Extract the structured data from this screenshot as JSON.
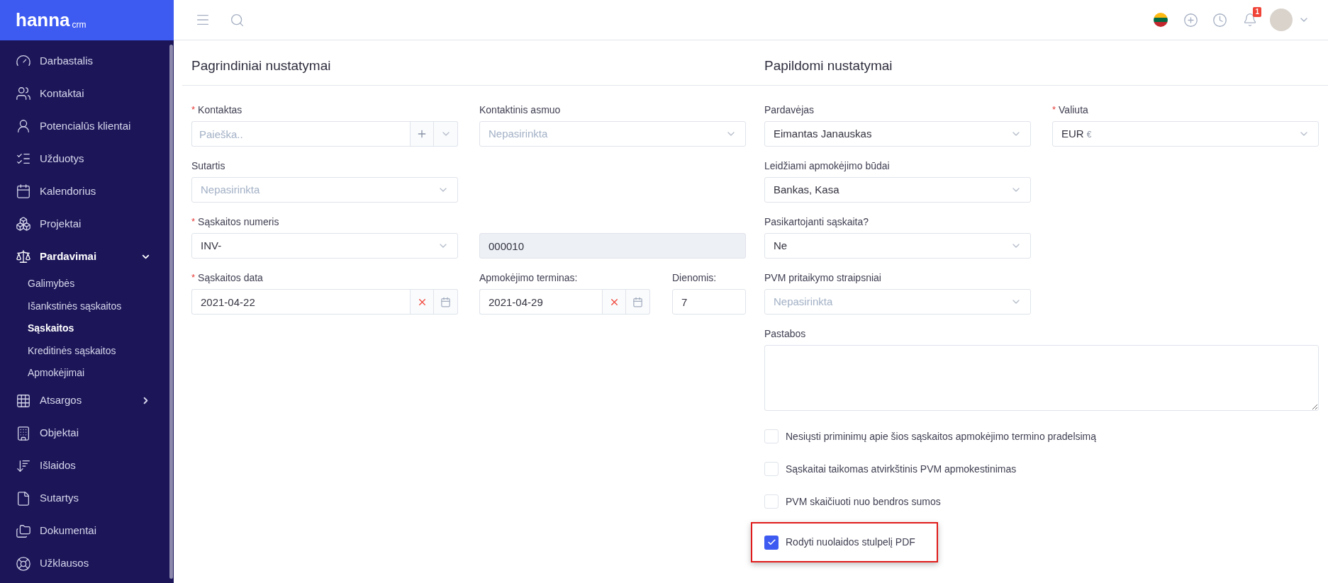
{
  "logo": {
    "name": "hanna",
    "suffix": "crm"
  },
  "sidebar": {
    "items": [
      {
        "label": "Darbastalis",
        "selected": false
      },
      {
        "label": "Kontaktai",
        "selected": false
      },
      {
        "label": "Potencialūs klientai",
        "selected": false
      },
      {
        "label": "Užduotys",
        "selected": false
      },
      {
        "label": "Kalendorius",
        "selected": false
      },
      {
        "label": "Projektai",
        "selected": false
      },
      {
        "label": "Pardavimai",
        "selected": true,
        "expanded": true,
        "children": [
          {
            "label": "Galimybės",
            "selected": false
          },
          {
            "label": "Išankstinės sąskaitos",
            "selected": false
          },
          {
            "label": "Sąskaitos",
            "selected": true
          },
          {
            "label": "Kreditinės sąskaitos",
            "selected": false
          },
          {
            "label": "Apmokėjimai",
            "selected": false
          }
        ]
      },
      {
        "label": "Atsargos",
        "selected": false,
        "expanded": false
      },
      {
        "label": "Objektai",
        "selected": false
      },
      {
        "label": "Išlaidos",
        "selected": false
      },
      {
        "label": "Sutartys",
        "selected": false
      },
      {
        "label": "Dokumentai",
        "selected": false
      },
      {
        "label": "Užklausos",
        "selected": false
      }
    ]
  },
  "topbar": {
    "notifications": "1"
  },
  "sections": [
    {
      "title": "Pagrindiniai nustatymai",
      "rows": [
        [
          [
            {
              "kind": "search",
              "label": "Kontaktas",
              "required_mark": "*",
              "placeholder": "Paieška.."
            }
          ],
          [
            {
              "kind": "select",
              "label": "Kontaktinis asmuo",
              "placeholder": "Nepasirinkta"
            }
          ]
        ],
        [
          [
            {
              "kind": "select",
              "label": "Sutartis",
              "placeholder": "Nepasirinkta"
            }
          ]
        ],
        [
          [
            {
              "kind": "select",
              "label": "Sąskaitos numeris",
              "required_mark": "*",
              "value": "INV-"
            }
          ],
          [
            {
              "kind": "readonly",
              "value": "000010"
            }
          ]
        ],
        [
          [
            {
              "kind": "date",
              "label": "Sąskaitos data",
              "required_mark": "*",
              "value": "2021-04-22"
            }
          ],
          [
            {
              "kind": "date",
              "label": "Apmokėjimo terminas:",
              "value": "2021-04-29"
            },
            {
              "kind": "text",
              "label": "Dienomis:",
              "value": "7"
            }
          ]
        ]
      ]
    },
    {
      "title": "Papildomi nustatymai",
      "rows": [
        [
          [
            {
              "kind": "select",
              "label": "Pardavėjas",
              "value": "Eimantas Janauskas"
            }
          ],
          [
            {
              "kind": "select",
              "label": "Valiuta",
              "required_mark": "*",
              "value": "EUR",
              "suffix": "€"
            }
          ]
        ],
        [
          [
            {
              "kind": "select",
              "label": "Leidžiami apmokėjimo būdai",
              "value": "Bankas, Kasa"
            }
          ]
        ],
        [
          [
            {
              "kind": "select",
              "label": "Pasikartojanti sąskaita?",
              "value": "Ne"
            }
          ]
        ],
        [
          [
            {
              "kind": "select",
              "label": "PVM pritaikymo straipsniai",
              "placeholder": "Nepasirinkta"
            }
          ]
        ],
        [
          [
            {
              "kind": "textarea",
              "label": "Pastabos"
            }
          ]
        ]
      ],
      "checkboxes": [
        {
          "label": "Nesiųsti priminimų apie šios sąskaitos apmokėjimo termino pradelsimą",
          "checked": false,
          "highlighted": false
        },
        {
          "label": "Sąskaitai taikomas atvirkštinis PVM apmokestinimas",
          "checked": false,
          "highlighted": false
        },
        {
          "label": "PVM skaičiuoti nuo bendros sumos",
          "checked": false,
          "highlighted": false
        },
        {
          "label": "Rodyti nuolaidos stulpelį PDF",
          "checked": true,
          "highlighted": true
        }
      ]
    }
  ]
}
